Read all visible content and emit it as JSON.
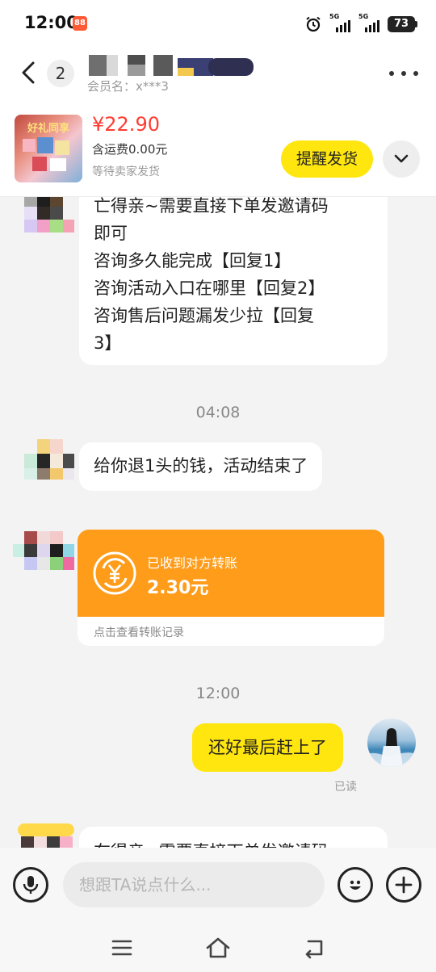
{
  "status_bar": {
    "time": "12:00",
    "app_badge": "88",
    "signal_1_label": "5G",
    "signal_2_label": "5G",
    "battery": "73"
  },
  "header": {
    "unread_count": "2",
    "member_label": "会员名：x***3"
  },
  "order": {
    "price": "¥22.90",
    "shipping": "含运费0.00元",
    "status": "等待卖家发货",
    "remind_button": "提醒发货",
    "thumbnail_text": "好礼同享"
  },
  "messages": {
    "first_bubble": [
      "亡得亲~需要直接下单发邀请码",
      "即可",
      "咨询多久能完成【回复1】",
      "咨询活动入口在哪里【回复2】",
      "咨询售后问题漏发少拉【回复",
      "3】"
    ],
    "timestamp_1": "04:08",
    "refund_text": "给你退1头的钱，活动结束了",
    "transfer": {
      "title": "已收到对方转账",
      "amount": "2.30元",
      "link": "点击查看转账记录"
    },
    "timestamp_2": "12:00",
    "my_reply": "还好最后赶上了",
    "read_status": "已读",
    "partial_bubble": "在得亲~需要直接下单发邀请码"
  },
  "input": {
    "placeholder": "想跟TA说点什么..."
  },
  "icons": {
    "back": "chevron-left-icon",
    "more": "more-dots-icon",
    "expand": "chevron-down-icon",
    "transfer": "yuan-exchange-icon",
    "mic": "microphone-icon",
    "emoji": "smile-icon",
    "plus": "plus-icon",
    "nav_menu": "menu-icon",
    "nav_home": "home-icon",
    "nav_back": "back-icon"
  },
  "colors": {
    "accent_yellow": "#ffe60f",
    "transfer_orange": "#ff9c1a",
    "price_red": "#ff3b30",
    "chat_background": "#f3f3f3"
  }
}
